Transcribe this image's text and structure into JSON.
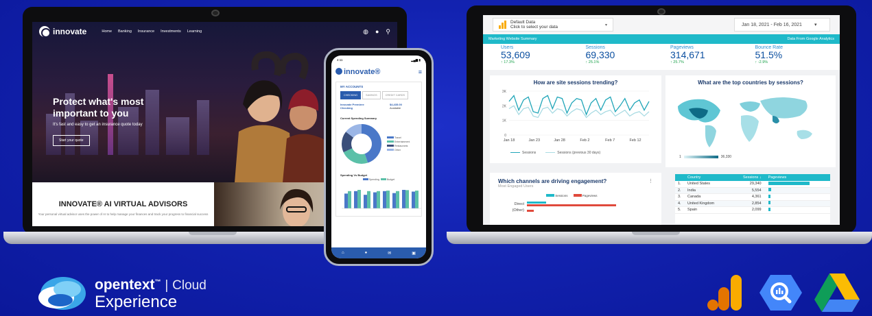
{
  "site": {
    "brand": "innovate",
    "menu": [
      "Home",
      "Banking",
      "Insurance",
      "Investments",
      "Learning"
    ],
    "hero_title": "Protect what's most important to you",
    "hero_sub": "It's fast and easy to get an insurance quote today",
    "hero_button": "Start your quote",
    "advisors_title": "INNOVATE® AI VIRTUAL ADVISORS",
    "advisors_sub": "Your personal virtual advisor uses the power of AI to help manage your finances and track your progress to financial success"
  },
  "phone": {
    "time": "4:11",
    "brand": "innovate®",
    "accounts_title": "MY ACCOUNTS",
    "tabs": [
      "CHECKING",
      "SAVINGS",
      "CREDIT CARDS"
    ],
    "account_name": "Innovate Premiere Checking",
    "account_value": "$4,435.00",
    "account_status": "Available",
    "spending_title": "Current Spending Summary",
    "spending_legend": [
      "Travel",
      "Entertainment",
      "Restaurants",
      "Other"
    ],
    "budget_title": "Spending Vs Budget",
    "budget_legend": [
      "Spending",
      "Budget"
    ]
  },
  "dashboard": {
    "source_label": "Default Data",
    "source_sub": "Click to select your data",
    "date_range": "Jan 18, 2021 - Feb 16, 2021",
    "banner_left": "Marketing Website Summary",
    "banner_right": "Data From Google Analytics",
    "kpis": [
      {
        "label": "Users",
        "value": "53,609",
        "delta": "↑ 17.3%"
      },
      {
        "label": "Sessions",
        "value": "69,330",
        "delta": "↑ 25.1%"
      },
      {
        "label": "Pageviews",
        "value": "314,671",
        "delta": "↑ 25.7%"
      },
      {
        "label": "Bounce Rate",
        "value": "51.5%",
        "delta": "↑ -2.9%"
      }
    ],
    "trend_title": "How are site sessions trending?",
    "trend_legend": [
      "Sessions",
      "Sessions (previous 30 days)"
    ],
    "map_title": "What are the top countries by sessions?",
    "map_scale": [
      "1",
      "36,330"
    ],
    "channels_title": "Which channels are driving engagement?",
    "channels_sub": "Most Engaged Users",
    "channels_legend": [
      "Sessions",
      "Pageviews"
    ],
    "channels": [
      "Direct",
      "(Other)"
    ],
    "table_headers": [
      "Country",
      "Sessions ↓",
      "Pageviews"
    ],
    "table_rows": [
      {
        "n": "1.",
        "country": "United States",
        "sessions": "29,340",
        "pv": 1.0
      },
      {
        "n": "2.",
        "country": "India",
        "sessions": "5,554",
        "pv": 0.07
      },
      {
        "n": "3.",
        "country": "Canada",
        "sessions": "4,361",
        "pv": 0.06
      },
      {
        "n": "4.",
        "country": "United Kingdom",
        "sessions": "2,854",
        "pv": 0.05
      },
      {
        "n": "5.",
        "country": "Spain",
        "sessions": "2,099",
        "pv": 0.03
      }
    ]
  },
  "chart_data": {
    "type": "line",
    "x": [
      "Jan 18",
      "Jan 23",
      "Jan 28",
      "Feb 2",
      "Feb 7",
      "Feb 12"
    ],
    "ylim": [
      0,
      3000
    ],
    "yticks": [
      "0",
      "1K",
      "2K",
      "3K"
    ],
    "series": [
      {
        "name": "Sessions",
        "values": [
          2300,
          2700,
          1700,
          2400,
          2600,
          1600,
          1500,
          2500,
          2700,
          1800,
          2600,
          2500,
          1500,
          2200,
          2500,
          2400,
          1400,
          2200,
          2500,
          1700,
          2400,
          2600,
          1600,
          2000,
          2500,
          1700,
          2200,
          2400,
          1700,
          2300
        ]
      },
      {
        "name": "Sessions (previous 30 days)",
        "values": [
          1800,
          2000,
          1400,
          1800,
          1900,
          1300,
          1200,
          1800,
          1900,
          1500,
          1800,
          1700,
          1300,
          1600,
          1800,
          1700,
          1200,
          1500,
          1700,
          1400,
          1600,
          1700,
          1300,
          1500,
          1700,
          1300,
          1500,
          1600,
          1300,
          1600
        ]
      }
    ]
  },
  "bottom": {
    "ot_brand": "opentext",
    "ot_tm": "™",
    "ot_cloud": "Cloud",
    "ot_experience": "Experience"
  },
  "colors": {
    "accent": "#1fb9c9",
    "brand_blue": "#2a5cad",
    "background": "#1222b0"
  }
}
